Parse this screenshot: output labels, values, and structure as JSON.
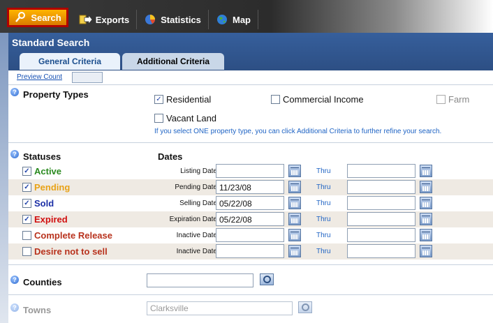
{
  "toolbar": {
    "search": "Search",
    "exports": "Exports",
    "statistics": "Statistics",
    "map": "Map"
  },
  "header": {
    "title": "Standard Search",
    "tab_general": "General Criteria",
    "tab_additional": "Additional Criteria"
  },
  "preview": {
    "link": "Preview Count"
  },
  "property_types": {
    "label": "Property Types",
    "residential": "Residential",
    "commercial": "Commercial Income",
    "farm": "Farm",
    "vacant": "Vacant Land",
    "hint": "If you select ONE property type, you can click Additional Criteria to further refine your search."
  },
  "statuses": {
    "label": "Statuses",
    "dates_label": "Dates",
    "thru": "Thru",
    "rows": [
      {
        "name": "Active",
        "date_label": "Listing Date",
        "from": "",
        "color": "#2a8a1f",
        "checked": true
      },
      {
        "name": "Pending",
        "date_label": "Pending Date",
        "from": "11/23/08",
        "color": "#e8a216",
        "checked": true
      },
      {
        "name": "Sold",
        "date_label": "Selling Date",
        "from": "05/22/08",
        "color": "#1b2fa6",
        "checked": true
      },
      {
        "name": "Expired",
        "date_label": "Expiration Date",
        "from": "05/22/08",
        "color": "#d10f0f",
        "checked": true
      },
      {
        "name": "Complete Release",
        "date_label": "Inactive Date",
        "from": "",
        "color": "#b8321d",
        "checked": false
      },
      {
        "name": "Desire not to sell",
        "date_label": "Inactive Date",
        "from": "",
        "color": "#b8321d",
        "checked": false
      }
    ]
  },
  "counties": {
    "label": "Counties",
    "value": ""
  },
  "towns": {
    "label": "Towns",
    "value": "Clarksville"
  },
  "colors": {
    "toolbar_bg": "#2c2c2c",
    "header_bg": "#2d4f84",
    "search_highlight": "#b00000"
  }
}
